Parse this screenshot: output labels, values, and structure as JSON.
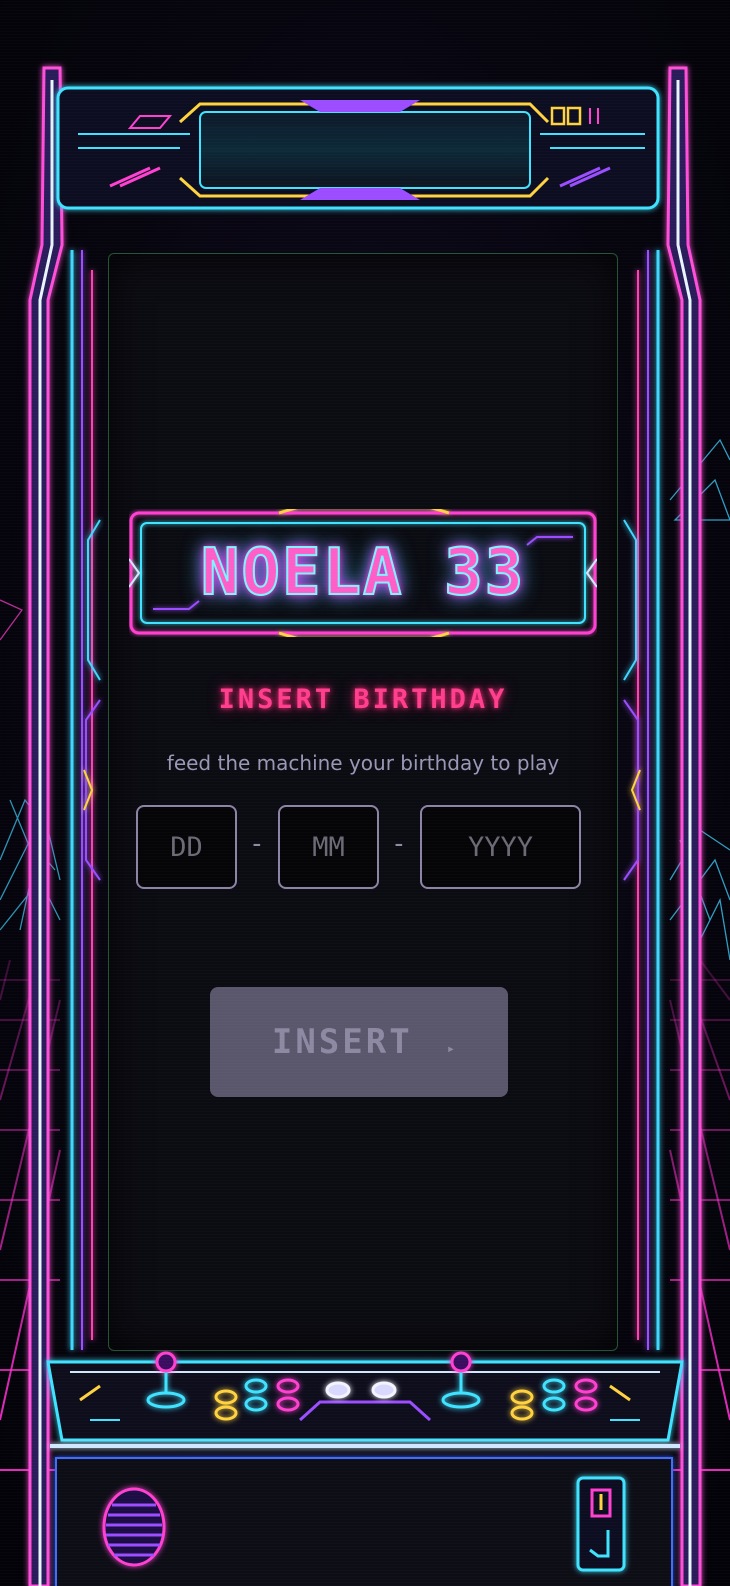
{
  "logo": {
    "text": "NOELA 33"
  },
  "headline": "INSERT BIRTHDAY",
  "subline": "feed the machine your birthday to play",
  "date_form": {
    "day": {
      "placeholder": "DD",
      "value": ""
    },
    "month": {
      "placeholder": "MM",
      "value": ""
    },
    "year": {
      "placeholder": "YYYY",
      "value": ""
    },
    "separator": "-"
  },
  "insert_button": {
    "label": "INSERT",
    "arrow": "▸",
    "state": "disabled"
  },
  "colors": {
    "neon_pink": "#ff3fb4",
    "neon_cyan": "#3fe3ff",
    "neon_purple": "#9b4dff",
    "neon_yellow": "#ffd23f",
    "headline_red": "#ff3f8e",
    "button_disabled": "#5a566c"
  },
  "icons": {
    "coin_slot": "coin-slot-icon",
    "speaker": "speaker-grille-icon",
    "joystick": "joystick-icon",
    "arcade_button": "arcade-button-icon"
  }
}
